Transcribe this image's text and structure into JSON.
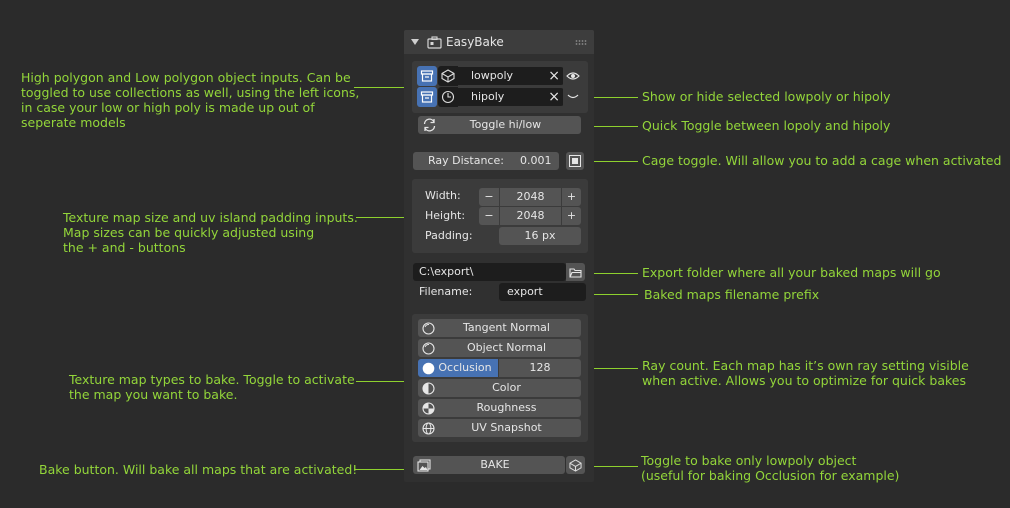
{
  "panel": {
    "title": "EasyBake",
    "objects": [
      {
        "name": "lowpoly"
      },
      {
        "name": "hipoly"
      }
    ],
    "toggle_label": "Toggle hi/low",
    "ray_distance_label": "Ray Distance:",
    "ray_distance_value": "0.001",
    "width_label": "Width:",
    "width_value": "2048",
    "height_label": "Height:",
    "height_value": "2048",
    "padding_label": "Padding:",
    "padding_value": "16 px",
    "export_path": "C:\\export\\",
    "filename_label": "Filename:",
    "filename_value": "export",
    "maps": [
      {
        "label": "Tangent Normal",
        "active": false
      },
      {
        "label": "Object Normal",
        "active": false
      },
      {
        "label": "Occlusion",
        "active": true,
        "rays": "128"
      },
      {
        "label": "Color",
        "active": false
      },
      {
        "label": "Roughness",
        "active": false
      },
      {
        "label": "UV Snapshot",
        "active": false
      }
    ],
    "bake_label": "BAKE",
    "minus": "−",
    "plus": "+",
    "close": "×"
  },
  "notes": {
    "objects": "High polygon and Low polygon object inputs. Can be\ntoggled to use collections as well, using the left icons,\nin case your low or high poly is made up out of\nseperate models",
    "show_hide": "Show or hide selected lowpoly or hipoly",
    "quick_toggle": "Quick Toggle between lopoly and hipoly",
    "cage": "Cage toggle. Will allow you to add a cage when activated",
    "texture_size": "Texture map size and uv island padding inputs.\nMap sizes can be quickly adjusted using\nthe + and - buttons",
    "export": "Export folder where all your baked maps will go",
    "prefix": "Baked maps filename prefix",
    "ray_count": "Ray count. Each map has it’s own ray setting visible\nwhen active. Allows you to optimize for quick bakes",
    "map_types": "Texture map types to bake. Toggle to activate\nthe map you want to bake.",
    "bake": "Bake button. Will bake all maps that are activated!",
    "lowpoly_only": "Toggle to bake only lowpoly object\n(useful for baking Occlusion for example)"
  },
  "colors": {
    "accent": "#4772b3",
    "annotation": "#93d63a",
    "panel": "#303030"
  }
}
